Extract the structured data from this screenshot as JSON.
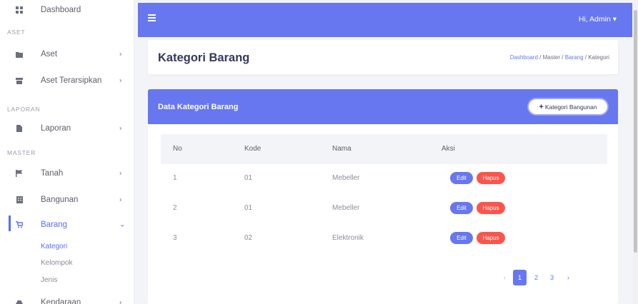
{
  "sidebar": {
    "dashboard": "Dashboard",
    "head_aset": "ASET",
    "aset": "Aset",
    "aset_terarsipkan": "Aset Terarsipkan",
    "head_laporan": "LAPORAN",
    "laporan": "Laporan",
    "head_master": "MASTER",
    "tanah": "Tanah",
    "bangunan": "Bangunan",
    "barang": "Barang",
    "sub_kategori": "Kategori",
    "sub_kelompok": "Kelompok",
    "sub_jenis": "Jenis",
    "kendaraan": "Kendaraan"
  },
  "topbar": {
    "user": "Hi, Admin ▾"
  },
  "header": {
    "title": "Kategori Barang",
    "breadcrumb": [
      "Dashboard",
      "Master",
      "Barang",
      "Kategori"
    ]
  },
  "card": {
    "title": "Data Kategori Barang",
    "add_button": "Kategori Bangunan"
  },
  "table": {
    "columns": [
      "No",
      "Kode",
      "Nama",
      "Aksi"
    ],
    "rows": [
      {
        "no": "1",
        "kode": "01",
        "nama": "Mebeller"
      },
      {
        "no": "2",
        "kode": "01",
        "nama": "Mebeller"
      },
      {
        "no": "3",
        "kode": "02",
        "nama": "Elektronik"
      }
    ],
    "edit_label": "Edit",
    "delete_label": "Hapus"
  },
  "pagination": {
    "prev": "‹",
    "pages": [
      "1",
      "2",
      "3"
    ],
    "next": "›",
    "current": "1"
  },
  "colors": {
    "primary": "#6777ef",
    "danger": "#fc544b"
  }
}
